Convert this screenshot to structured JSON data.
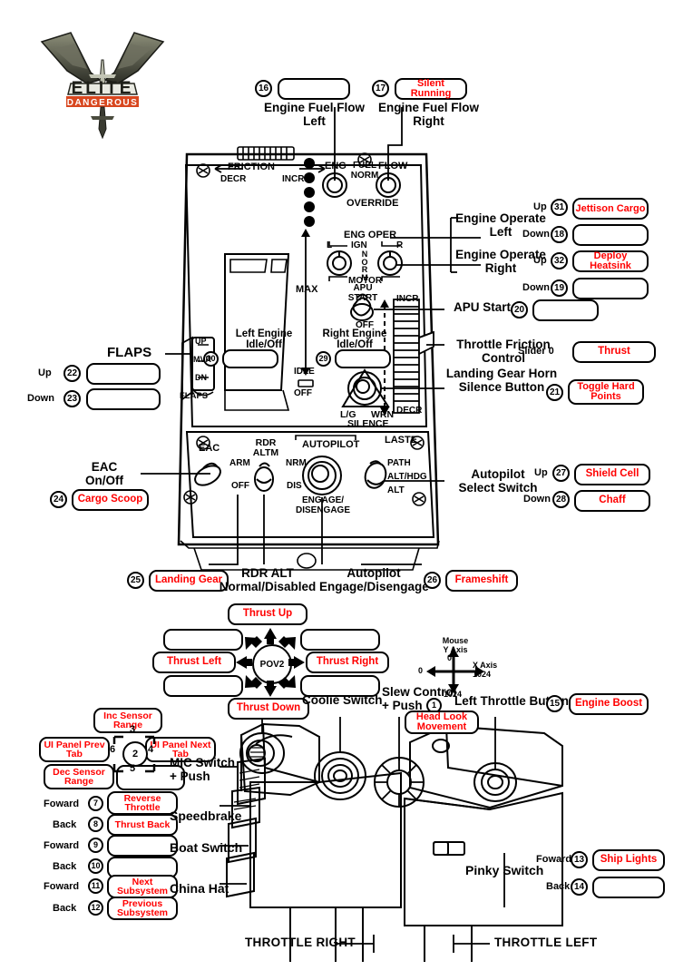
{
  "meta": {
    "logo_alt": "Elite Dangerous",
    "logo_word": "ELITE",
    "logo_sub": "DANGEROUS"
  },
  "colors": {
    "binding_text": "#ff0000",
    "outline": "#000000",
    "background": "#ffffff"
  },
  "top_row": {
    "left": {
      "num": "16",
      "binding": "",
      "label": "Engine Fuel Flow\nLeft"
    },
    "right": {
      "num": "17",
      "binding": "Silent\nRunning",
      "label": "Engine Fuel Flow\nRight"
    }
  },
  "panel_text": {
    "friction": "FRICTION",
    "friction_decr": "DECR",
    "friction_incr": "INCR",
    "eng": "ENG",
    "fuel_norm": "FUEL\nNORM",
    "flow": "FLOW",
    "override": "OVERRIDE",
    "eng_oper": "ENG OPER",
    "ign": "IGN",
    "ign_l": "L",
    "ign_r": "R",
    "norm": "NORM",
    "motor": "MOTOR",
    "apu_start": "APU\nSTART",
    "apu_off": "OFF",
    "max": "MAX",
    "idle": "IDLE",
    "off": "OFF",
    "incr": "INCR",
    "decr": "DECR",
    "left_engine": "Left Engine\nIdle/Off",
    "right_engine": "Right Engine\nIdle/Off",
    "flaps_panel": "FLAPS",
    "flaps_up": "UP",
    "flaps_mvr": "MVR",
    "flaps_dn": "DN",
    "lg_silence_l": "L/G",
    "lg_silence_r": "WRN",
    "lg_silence_b": "SILENCE",
    "eac": "EAC",
    "eac_arm": "ARM",
    "eac_off": "OFF",
    "rdr_altm": "RDR\nALTM",
    "rdr_nrm": "NRM",
    "rdr_dis": "DIS",
    "autopilot": "AUTOPILOT",
    "engage": "ENGAGE/\nDISENGAGE",
    "laste": "LASTE",
    "laste_path": "PATH",
    "laste_althdg": "ALT/HDG",
    "laste_alt": "ALT"
  },
  "callouts_right": [
    {
      "id": "engine-operate-left",
      "label": "Engine Operate\nLeft",
      "dir_up": "Up",
      "num_up": "31",
      "bind_up": "Jettison\nCargo",
      "dir_down": "Down",
      "num_down": "18",
      "bind_down": ""
    },
    {
      "id": "engine-operate-right",
      "label": "Engine Operate\nRight",
      "dir_up": "Up",
      "num_up": "32",
      "bind_up": "Deploy\nHeatsink",
      "dir_down": "Down",
      "num_down": "19",
      "bind_down": ""
    }
  ],
  "apu": {
    "label": "APU Start",
    "num": "20",
    "binding": ""
  },
  "throttle_friction": {
    "label": "Throttle Friction\nControl",
    "slider_label": "Slider 0",
    "binding": "Thrust"
  },
  "landing_gear_horn": {
    "label": "Landing Gear Horn\nSilence Button",
    "num": "21",
    "binding": "Toggle\nHard Points"
  },
  "flaps": {
    "label": "FLAPS",
    "up_dir": "Up",
    "up_num": "22",
    "up_bind": "",
    "down_dir": "Down",
    "down_num": "23",
    "down_bind": ""
  },
  "eac_callout": {
    "label": "EAC\nOn/Off",
    "num": "24",
    "binding": "Cargo Scoop"
  },
  "landing_gear": {
    "num": "25",
    "binding": "Landing Gear"
  },
  "rdr_alt": {
    "label": "RDR ALT\nNormal/Disabled"
  },
  "autopilot_engage": {
    "label": "Autopilot\nEngage/Disengage",
    "num": "26",
    "binding": "Frameshift"
  },
  "autopilot_select": {
    "label": "Autopilot\nSelect Switch",
    "up_dir": "Up",
    "up_num": "27",
    "up_bind": "Shield Cell",
    "down_dir": "Down",
    "down_num": "28",
    "down_bind": "Chaff"
  },
  "engine_idle": {
    "left_num": "30",
    "left_bind": "",
    "right_num": "29",
    "right_bind": ""
  },
  "pov": {
    "center_label": "POV2",
    "coolie_label": "Coolie Switch",
    "up": "Thrust Up",
    "down": "Thrust Down",
    "left": "Thrust Left",
    "right": "Thrust Right",
    "up_left": "",
    "up_right": "",
    "down_left": "",
    "down_right": ""
  },
  "mouse_axis": {
    "title": "Mouse\nY Axis",
    "y_top": "0",
    "y_bottom": "1024",
    "x_left": "0",
    "x_right_label": "X Axis",
    "x_right": "1024"
  },
  "slew": {
    "label": "Slew Control\n+ Push",
    "num": "1",
    "binding": "Head Look\nMovement"
  },
  "left_throttle_button": {
    "label": "Left Throttle Button",
    "num": "15",
    "binding": "Engine Boost"
  },
  "mic_switch": {
    "label": "MIC Switch\n+ Push",
    "center_num": "2",
    "center_bind": "",
    "up_num": "3",
    "up_bind": "Inc Sensor\nRange",
    "right_num": "4",
    "right_bind": "UI Panel\nNext Tab",
    "down_num": "5",
    "down_bind": "Dec Sensor\nRange",
    "left_num": "6",
    "left_bind": "UI Panel\nPrev Tab"
  },
  "speedbrake": {
    "label": "Speedbrake",
    "fwd_dir": "Foward",
    "fwd_num": "7",
    "fwd_bind": "Reverse\nThrottle",
    "back_dir": "Back",
    "back_num": "8",
    "back_bind": "Thrust Back"
  },
  "boat_switch": {
    "label": "Boat Switch",
    "fwd_dir": "Foward",
    "fwd_num": "9",
    "fwd_bind": "",
    "back_dir": "Back",
    "back_num": "10",
    "back_bind": ""
  },
  "china_hat": {
    "label": "China Hat",
    "fwd_dir": "Foward",
    "fwd_num": "11",
    "fwd_bind": "Next\nSubsystem",
    "back_dir": "Back",
    "back_num": "12",
    "back_bind": "Previous\nSubsystem"
  },
  "pinky_switch": {
    "label": "Pinky Switch",
    "fwd_dir": "Foward",
    "fwd_num": "13",
    "fwd_bind": "Ship Lights",
    "back_dir": "Back",
    "back_num": "14",
    "back_bind": ""
  },
  "bottom": {
    "throttle_right": "THROTTLE RIGHT",
    "throttle_left": "THROTTLE LEFT"
  }
}
